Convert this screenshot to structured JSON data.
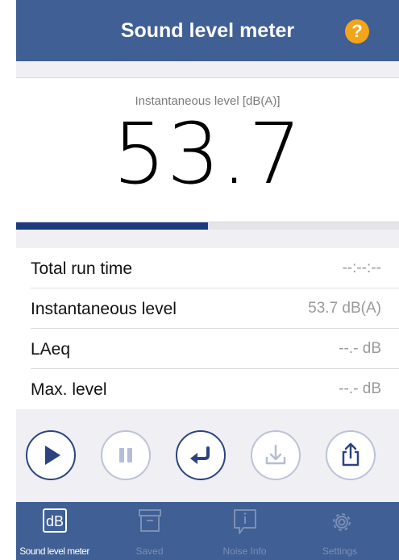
{
  "header": {
    "title": "Sound level meter",
    "help_icon": "?"
  },
  "level": {
    "caption": "Instantaneous level [dB(A)]",
    "value": "53.7",
    "bar_fraction": 0.5
  },
  "stats": [
    {
      "label": "Total run time",
      "value": "--:--:--"
    },
    {
      "label": "Instantaneous level",
      "value": "53.7 dB(A)"
    },
    {
      "label": "LAeq",
      "value": "--.- dB"
    },
    {
      "label": "Max. level",
      "value": "--.- dB"
    }
  ],
  "controls": [
    "play-icon",
    "pause-icon",
    "return-icon",
    "download-icon",
    "share-icon"
  ],
  "tabs": {
    "db_icon_text": "dB",
    "items": [
      {
        "label": "Sound level meter",
        "icon": "db-icon",
        "selected": true
      },
      {
        "label": "Saved",
        "icon": "archive-box-icon",
        "selected": false
      },
      {
        "label": "Noise Info",
        "icon": "info-icon",
        "selected": false
      },
      {
        "label": "Settings",
        "icon": "gear-icon",
        "selected": false
      }
    ]
  },
  "colors": {
    "brand": "#3f5f95",
    "accent": "#f2a51a",
    "bar": "#1d3a7c"
  }
}
